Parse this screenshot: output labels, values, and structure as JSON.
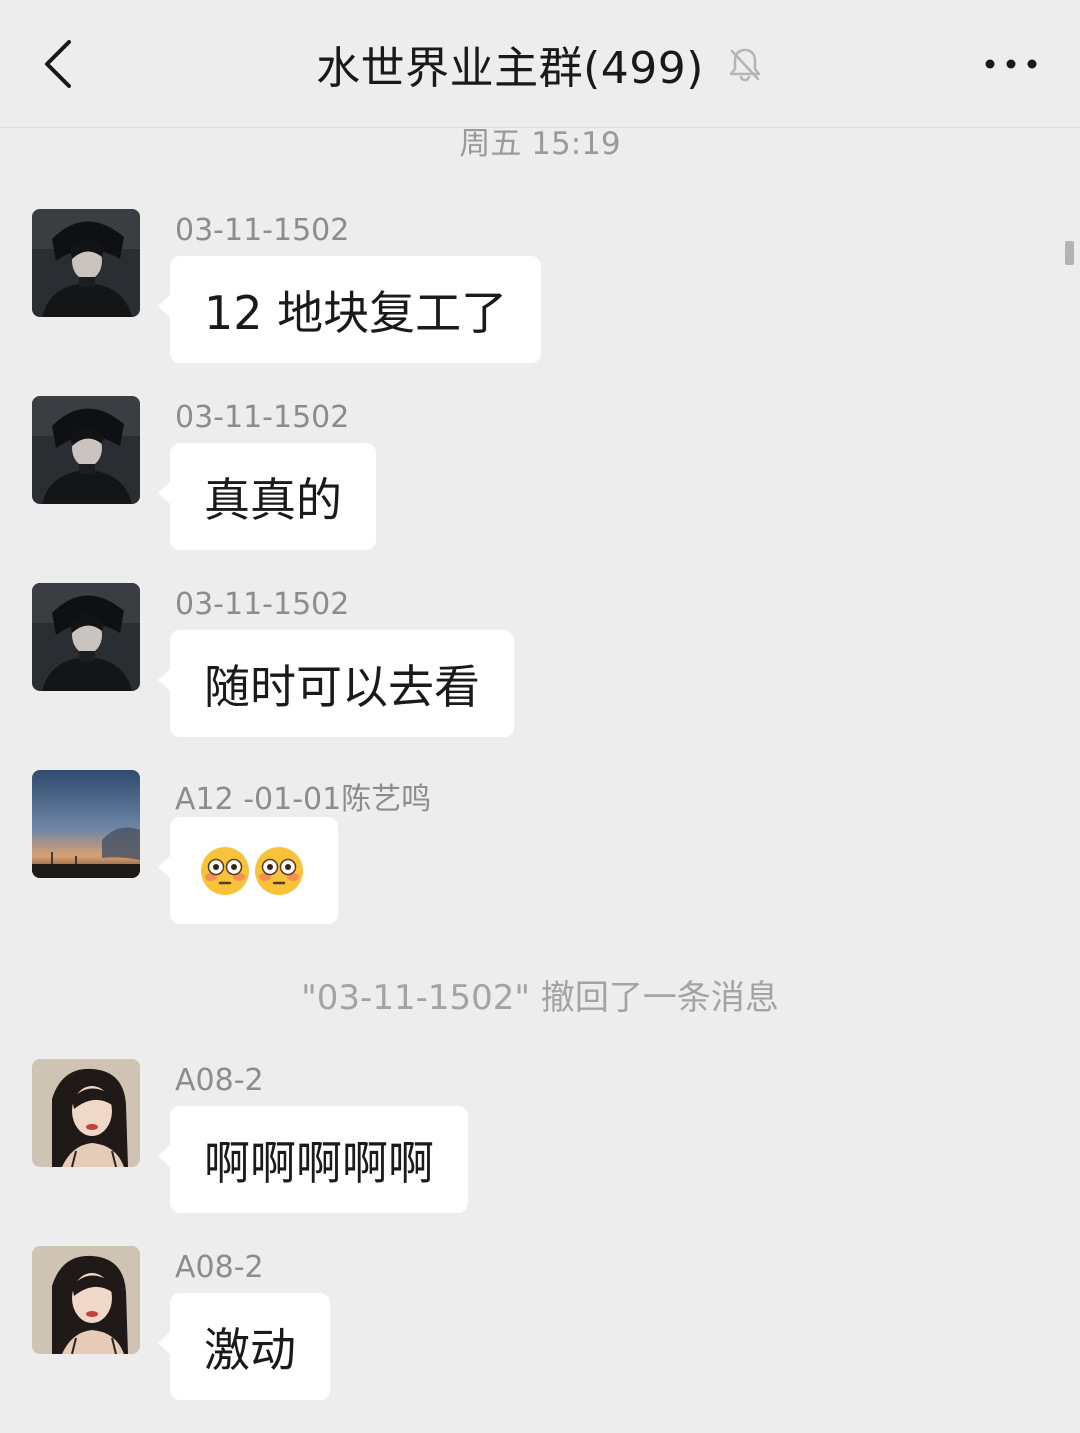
{
  "header": {
    "title": "水世界业主群(499)",
    "back_icon": "chevron-left-icon",
    "mute_icon": "bell-off-icon",
    "more_icon": "more-horizontal-icon"
  },
  "chat": {
    "time_divider": "周五 15:19",
    "messages": [
      {
        "sender": "03-11-1502",
        "text": "12 地块复工了",
        "avatar": "dark-haired-illustration-avatar"
      },
      {
        "sender": "03-11-1502",
        "text": "真真的",
        "avatar": "dark-haired-illustration-avatar"
      },
      {
        "sender": "03-11-1502",
        "text": "随时可以去看",
        "avatar": "dark-haired-illustration-avatar"
      },
      {
        "sender": "A12 -01-01陈艺鸣",
        "text": "",
        "emojis": [
          "flushed-face-emoji",
          "flushed-face-emoji"
        ],
        "avatar": "dusk-sky-avatar"
      },
      {
        "sender": "A08-2",
        "text": "啊啊啊啊啊",
        "avatar": "woman-portrait-avatar"
      },
      {
        "sender": "A08-2",
        "text": "激动",
        "avatar": "woman-portrait-avatar"
      }
    ],
    "system_message": "\"03-11-1502\" 撤回了一条消息"
  },
  "colors": {
    "background": "#ededed",
    "bubble": "#ffffff",
    "meta_text": "#8c8c8c"
  }
}
